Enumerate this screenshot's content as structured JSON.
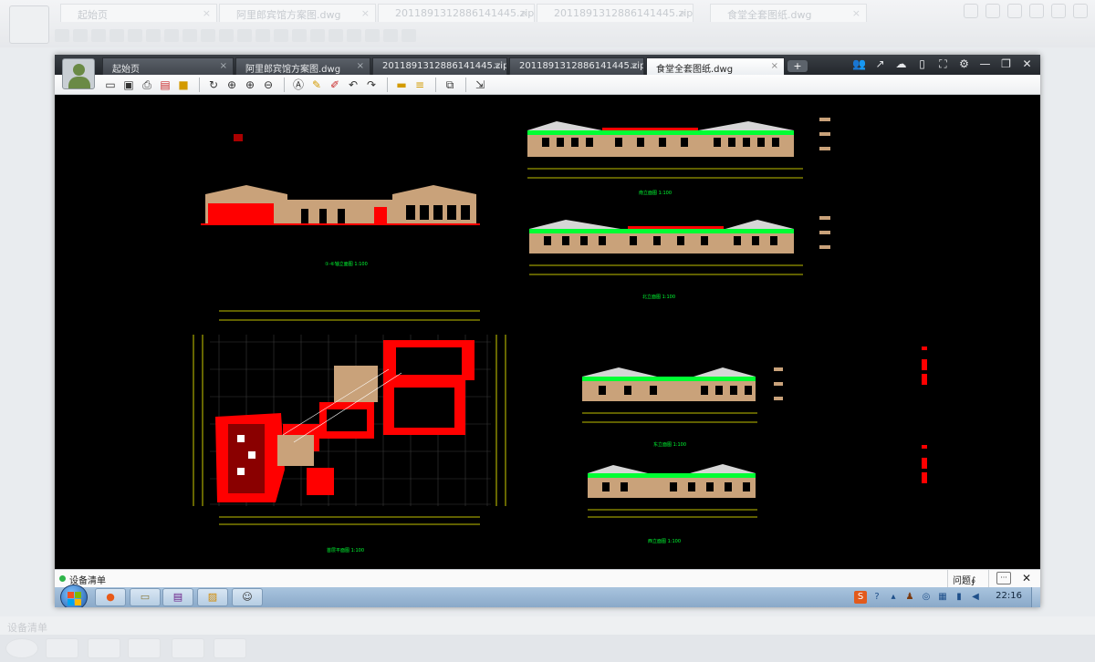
{
  "outer": {
    "tabs": [
      "起始页",
      "阿里郎宾馆方案图.dwg",
      "20118913128861414​45.zip",
      "2011891312886141445.zip",
      "食堂全套图纸.dwg"
    ],
    "bottom_label": "设备清单"
  },
  "window": {
    "tabs": [
      {
        "label": "起始页",
        "close": "×"
      },
      {
        "label": "阿里郎宾馆方案图.dwg",
        "close": "×"
      },
      {
        "label": "2011891312886141445.zip...",
        "close": "×"
      },
      {
        "label": "2011891312886141445.zip...",
        "close": "×"
      },
      {
        "label": "食堂全套图纸.dwg",
        "close": "×",
        "active": true
      }
    ],
    "new_tab": "+",
    "controls": [
      "👥",
      "↗",
      "☁",
      "▯",
      "⛶",
      "⚙",
      "—",
      "❐",
      "✕"
    ],
    "toolbar_icons": [
      "open",
      "save",
      "print",
      "pdf",
      "lock",
      "|",
      "rotate",
      "zoom-window",
      "zoom-in",
      "zoom-out",
      "|",
      "text",
      "pencil",
      "marker",
      "undo",
      "redo",
      "|",
      "measure",
      "dimension",
      "|",
      "layers",
      "|",
      "export"
    ]
  },
  "drawings": {
    "labels": {
      "elev_left": "①-⑥轴立面图 1:100",
      "elev_top1": "南立面图 1:100",
      "elev_top2": "北立面图 1:100",
      "elev_mid1": "东立面图 1:100",
      "elev_mid2": "西立面图 1:100",
      "plan": "首层平面图 1:100"
    },
    "colors": {
      "background": "#000000",
      "roof_green": "#00ff33",
      "wall_red": "#ff0000",
      "dim_yellow": "#ffff00",
      "facade_tan": "#c9a27a"
    }
  },
  "status": {
    "left_label": "设备清单",
    "question": "问题∮",
    "chat": "···",
    "close": "✕"
  },
  "taskbar": {
    "time": "22:16",
    "apps": [
      "browser",
      "folder",
      "books",
      "photos",
      "viewer"
    ]
  }
}
